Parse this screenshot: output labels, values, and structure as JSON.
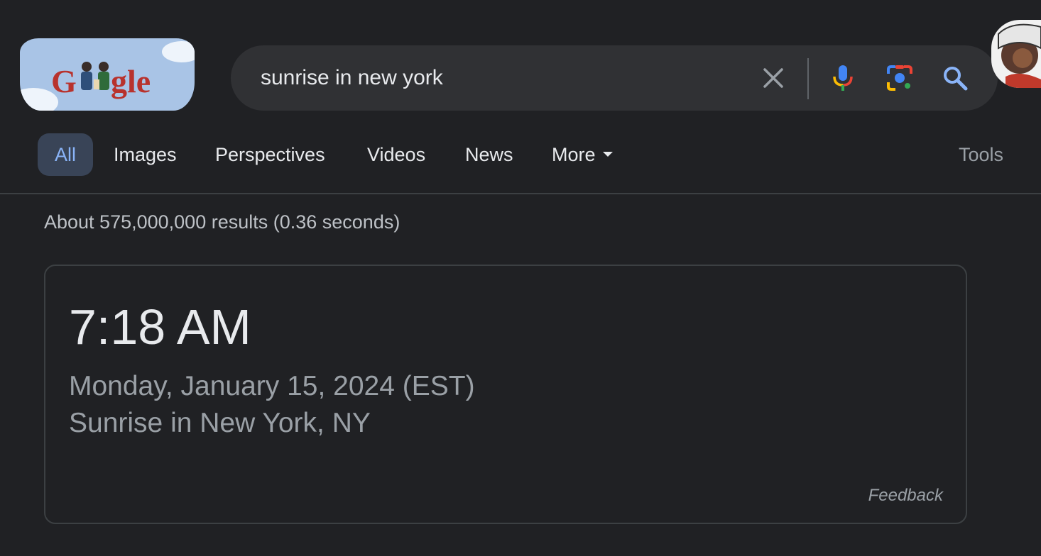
{
  "search": {
    "query": "sunrise in new york"
  },
  "tabs": [
    {
      "label": "All",
      "active": true
    },
    {
      "label": "Images"
    },
    {
      "label": "Perspectives"
    },
    {
      "label": "Videos"
    },
    {
      "label": "News"
    },
    {
      "label": "More"
    }
  ],
  "tools_label": "Tools",
  "result_stats": "About 575,000,000 results (0.36 seconds)",
  "answer_card": {
    "time": "7:18 AM",
    "date": "Monday, January 15, 2024 (EST)",
    "place": "Sunrise in New York, NY",
    "feedback_label": "Feedback"
  },
  "colors": {
    "background": "#202124",
    "searchbox": "#303134",
    "active_tab_bg": "#394457",
    "active_tab_text": "#8ab4f8",
    "muted_text": "#9aa0a6"
  },
  "icons": {
    "clear": "close-icon",
    "voice": "microphone-icon",
    "lens": "camera-lens-icon",
    "search": "search-icon"
  }
}
